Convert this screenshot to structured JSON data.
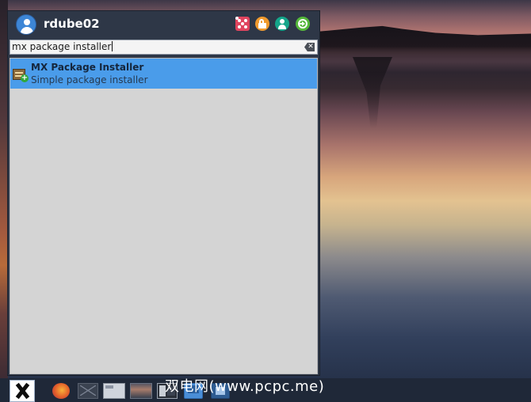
{
  "menu": {
    "username": "rdube02",
    "header_buttons": [
      {
        "name": "settings",
        "icon": "settings-icon",
        "color": "#e0445e"
      },
      {
        "name": "lock-screen",
        "icon": "lock-icon",
        "color": "#f09a2d"
      },
      {
        "name": "switch-user",
        "icon": "user-icon",
        "color": "#14a58a"
      },
      {
        "name": "log-out",
        "icon": "logout-icon",
        "color": "#54b83a"
      }
    ],
    "search": {
      "value": "mx package installer",
      "clear_glyph": "✕"
    },
    "results": [
      {
        "name": "MX Package Installer",
        "description": "Simple package installer",
        "icon": "package-installer-icon",
        "icon_badge": "+"
      }
    ],
    "highlight_color": "#4a9cea"
  },
  "taskbar": {
    "start_icon": "mx-logo-icon",
    "items": [
      {
        "icon": "firefox-icon"
      },
      {
        "icon": "mail-icon"
      },
      {
        "icon": "file-manager-icon"
      },
      {
        "icon": "window-thumbnail-icon"
      },
      {
        "icon": "terminal-icon"
      },
      {
        "icon": "folder-icon"
      },
      {
        "icon": "folder-home-icon"
      }
    ]
  },
  "watermark": "双电网(www.pcpc.me)"
}
